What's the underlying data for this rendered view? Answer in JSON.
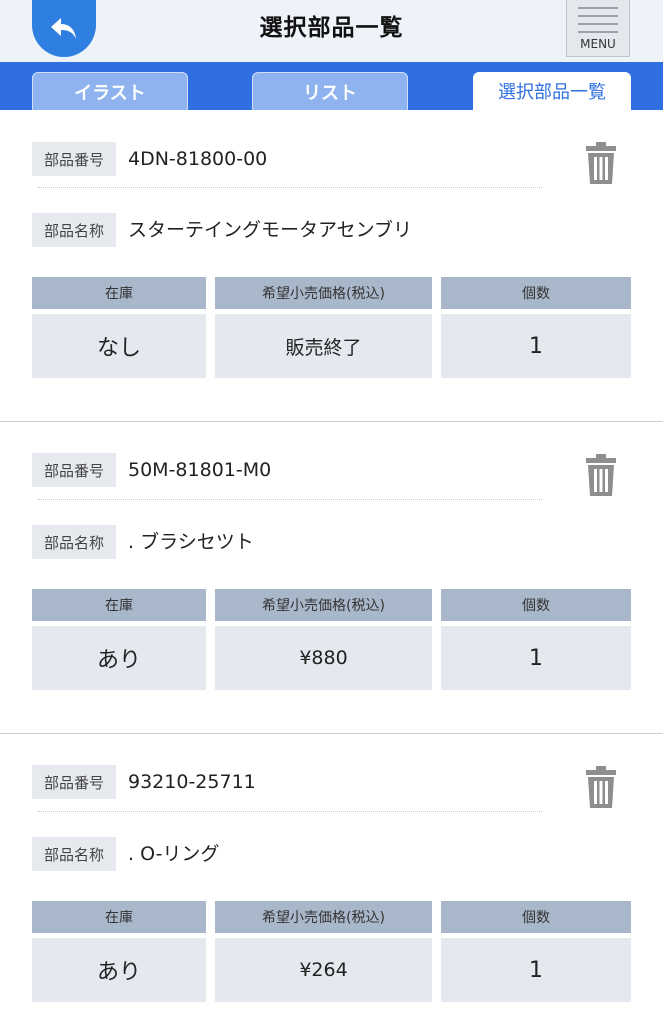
{
  "header": {
    "title": "選択部品一覧",
    "menu_label": "MENU"
  },
  "tabs": [
    {
      "label": "イラスト",
      "active": false
    },
    {
      "label": "リスト",
      "active": false
    },
    {
      "label": "選択部品一覧",
      "active": true
    }
  ],
  "labels": {
    "part_number": "部品番号",
    "part_name": "部品名称",
    "stock": "在庫",
    "price": "希望小売価格(税込)",
    "quantity": "個数"
  },
  "parts": [
    {
      "number": "4DN-81800-00",
      "name": "スターテイングモータアセンブリ",
      "stock": "なし",
      "price": "販売終了",
      "quantity": "1"
    },
    {
      "number": "50M-81801-M0",
      "name": ". ブラシセツト",
      "stock": "あり",
      "price": "¥880",
      "quantity": "1"
    },
    {
      "number": "93210-25711",
      "name": ". O-リング",
      "stock": "あり",
      "price": "¥264",
      "quantity": "1"
    }
  ],
  "colors": {
    "accent": "#2f6fe0",
    "back_button": "#2f7fe0",
    "table_header": "#a9b7ca",
    "table_cell": "#e4e9f0",
    "trash": "#8e8e8e"
  },
  "icons": {
    "back": "back-arrow-icon",
    "menu": "hamburger-menu-icon",
    "delete": "trash-icon"
  }
}
